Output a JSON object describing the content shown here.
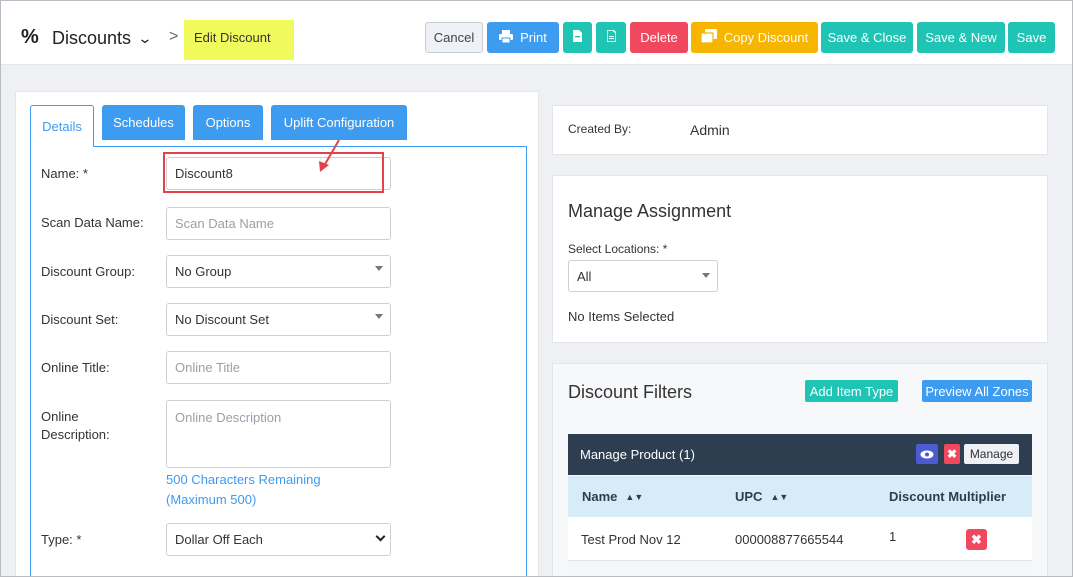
{
  "header": {
    "module_icon": "%",
    "module_title": "Discounts",
    "breadcrumb_separator": ">",
    "breadcrumb_current": "Edit Discount",
    "buttons": {
      "cancel": "Cancel",
      "print": "Print",
      "delete": "Delete",
      "copy_discount": "Copy Discount",
      "save_close": "Save & Close",
      "save_new": "Save & New",
      "save": "Save"
    }
  },
  "tabs": {
    "details": "Details",
    "schedules": "Schedules",
    "options": "Options",
    "uplift": "Uplift Configuration"
  },
  "form": {
    "name_label": "Name: *",
    "name_value": "Discount8",
    "scan_label": "Scan Data Name:",
    "scan_placeholder": "Scan Data Name",
    "group_label": "Discount Group:",
    "group_value": "No Group",
    "set_label": "Discount Set:",
    "set_value": "No Discount Set",
    "online_title_label": "Online Title:",
    "online_title_placeholder": "Online Title",
    "online_desc_label_1": "Online",
    "online_desc_label_2": "Description:",
    "online_desc_placeholder": "Online Description",
    "chars_remaining": "500 Characters Remaining",
    "max_chars": "(Maximum 500)",
    "type_label": "Type: *",
    "type_value": "Dollar Off Each"
  },
  "created": {
    "label": "Created By:",
    "value": "Admin"
  },
  "assignment": {
    "title": "Manage Assignment",
    "locations_label": "Select Locations: *",
    "locations_value": "All",
    "no_items": "No Items Selected"
  },
  "filters": {
    "title": "Discount Filters",
    "add_item_type": "Add Item Type",
    "preview_zones": "Preview All Zones",
    "manage_product_title": "Manage Product (1)",
    "manage_label": "Manage",
    "columns": {
      "name": "Name",
      "upc": "UPC",
      "multiplier": "Discount Multiplier"
    },
    "rows": [
      {
        "name": "Test Prod Nov 12",
        "upc": "000008877665544",
        "multiplier": "1"
      }
    ]
  },
  "colors": {
    "primary": "#3d9bf0",
    "teal": "#20c4b4",
    "danger": "#f0485e",
    "warning": "#f7b500",
    "highlight": "#f1fa5c",
    "dark_header": "#2c3e50"
  },
  "icons": {
    "module": "percent-icon",
    "dropdown": "chevron-down-icon",
    "print": "printer-icon",
    "doc1": "file-icon",
    "doc2": "file-text-icon",
    "copy": "copy-icon",
    "view": "eye-icon",
    "remove": "close-icon",
    "sort": "sort-icon"
  }
}
